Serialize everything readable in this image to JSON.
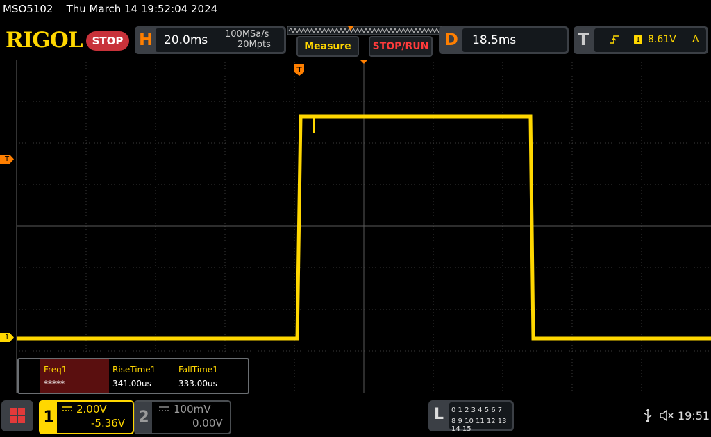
{
  "header": {
    "model": "MSO5102",
    "datetime": "Thu March 14 19:52:04 2024"
  },
  "logo": {
    "text": "RIGOL"
  },
  "run_state": {
    "label": "STOP",
    "color": "#c8323a"
  },
  "horizontal": {
    "letter": "H",
    "timebase": "20.0ms",
    "sample_rate": "100MSa/s",
    "memory_depth": "20Mpts"
  },
  "buttons": {
    "measure": "Measure",
    "stop_run": "STOP/RUN"
  },
  "delay": {
    "letter": "D",
    "value": "18.5ms"
  },
  "trigger": {
    "letter": "T",
    "source_channel": "1",
    "level": "8.61V",
    "mode": "A"
  },
  "markers": {
    "ch1": "1",
    "trigger_level": "T",
    "trigger_position": "T"
  },
  "measurements": [
    {
      "label": "Freq1",
      "value": "*****"
    },
    {
      "label": "RiseTime1",
      "value": "341.00us"
    },
    {
      "label": "FallTime1",
      "value": "333.00us"
    }
  ],
  "channels": {
    "ch1": {
      "number": "1",
      "scale": "2.00V",
      "offset": "-5.36V",
      "color": "#ffd700"
    },
    "ch2": {
      "number": "2",
      "scale": "100mV",
      "offset": "0.00V",
      "color": "#8a8a8a"
    }
  },
  "logic_analyzer": {
    "letter": "L",
    "row1": "0 1 2 3  4 5 6 7",
    "row2": "8 9 10 11 12 13 14 15"
  },
  "status": {
    "clock": "19:51",
    "icons": [
      "usb-icon",
      "mute-icon"
    ]
  },
  "colors": {
    "accent": "#ff7f00",
    "ch1_trace": "#ffd700",
    "brand": "#ffd700"
  }
}
